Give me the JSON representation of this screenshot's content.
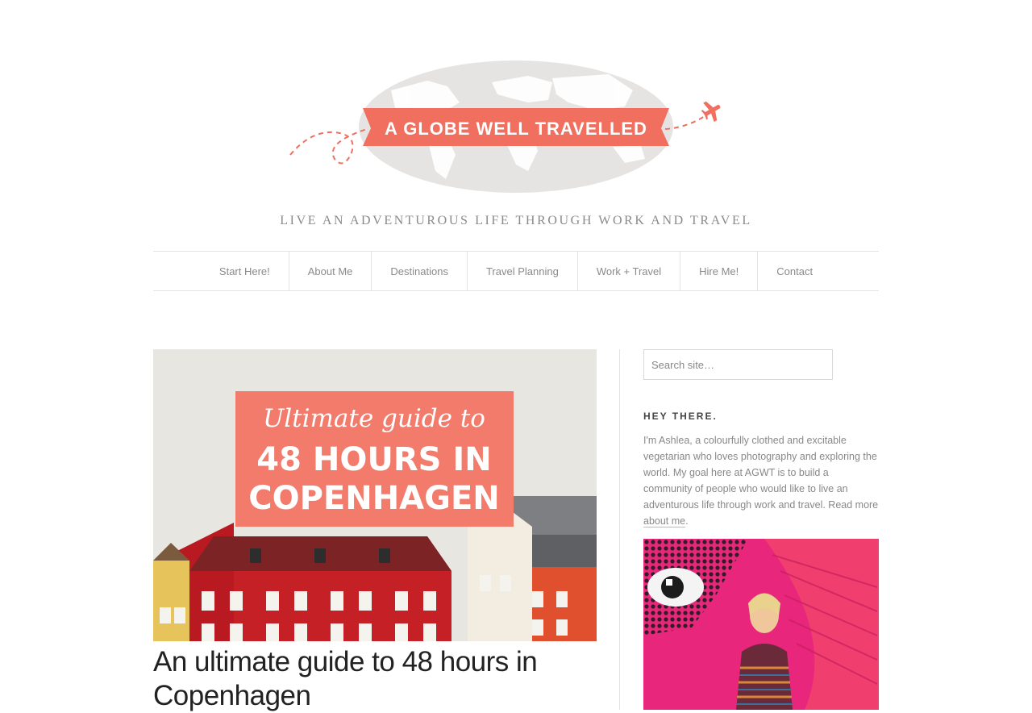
{
  "site": {
    "logo_text": "A GLOBE WELL TRAVELLED",
    "tagline": "LIVE AN ADVENTUROUS LIFE THROUGH WORK AND TRAVEL",
    "brand_color": "#f06f5f"
  },
  "nav": {
    "items": [
      {
        "label": "Start Here!"
      },
      {
        "label": "About Me"
      },
      {
        "label": "Destinations"
      },
      {
        "label": "Travel Planning"
      },
      {
        "label": "Work + Travel"
      },
      {
        "label": "Hire Me!"
      },
      {
        "label": "Contact"
      }
    ]
  },
  "post": {
    "image_line1": "Ultimate guide to",
    "image_line2": "48 HOURS IN",
    "image_line3": "COPENHAGEN",
    "title": "An ultimate guide to 48 hours in Copenhagen"
  },
  "sidebar": {
    "search_placeholder": "Search site…",
    "widget_title": "HEY THERE.",
    "about_text": "I'm Ashlea, a colourfully clothed and excitable vegetarian who loves photography and exploring the world. My goal here at AGWT is to build a community of people who would like to live an adventurous life through work and travel. Read more ",
    "about_link": "about me",
    "about_end": "."
  }
}
